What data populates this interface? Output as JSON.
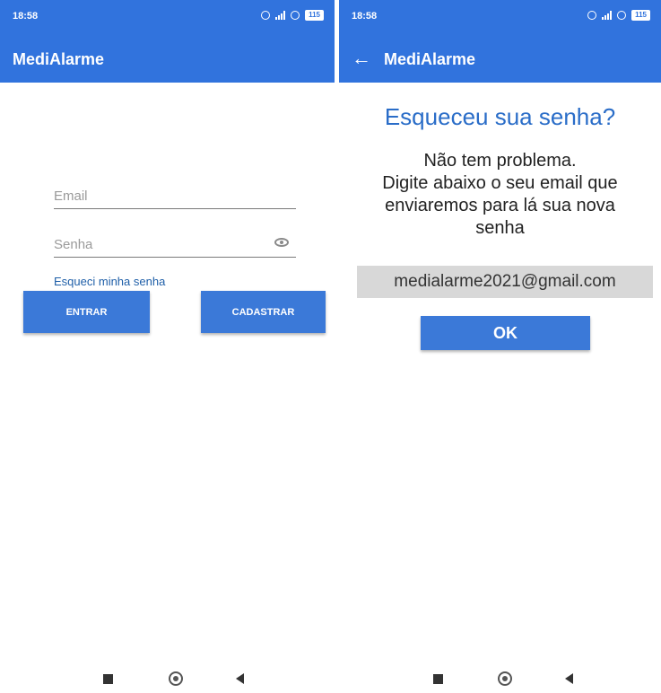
{
  "login": {
    "status": {
      "time": "18:58",
      "battery": "115"
    },
    "app_title": "MediAlarme",
    "email_placeholder": "Email",
    "password_placeholder": "Senha",
    "forgot_link": "Esqueci minha senha",
    "login_button": "ENTRAR",
    "register_button": "CADASTRAR"
  },
  "forgot": {
    "status": {
      "time": "18:58",
      "battery": "115"
    },
    "app_title": "MediAlarme",
    "heading": "Esqueceu sua senha?",
    "description_lines": [
      "Não tem problema.",
      "Digite abaixo o seu email que",
      "enviaremos para lá sua nova",
      "senha"
    ],
    "email_value": "medialarme2021@gmail.com",
    "ok_button": "OK"
  },
  "colors": {
    "app_bar": "#3173dd",
    "button": "#3b79d8",
    "heading": "#2a6dc8",
    "link": "#1f5fa8",
    "email_box": "#d8d8d8"
  },
  "icons": [
    "signal-icon",
    "alarm-icon",
    "wifi-icon",
    "battery-icon",
    "eye-icon",
    "back-arrow-icon",
    "nav-recents-icon",
    "nav-home-icon",
    "nav-back-icon"
  ]
}
